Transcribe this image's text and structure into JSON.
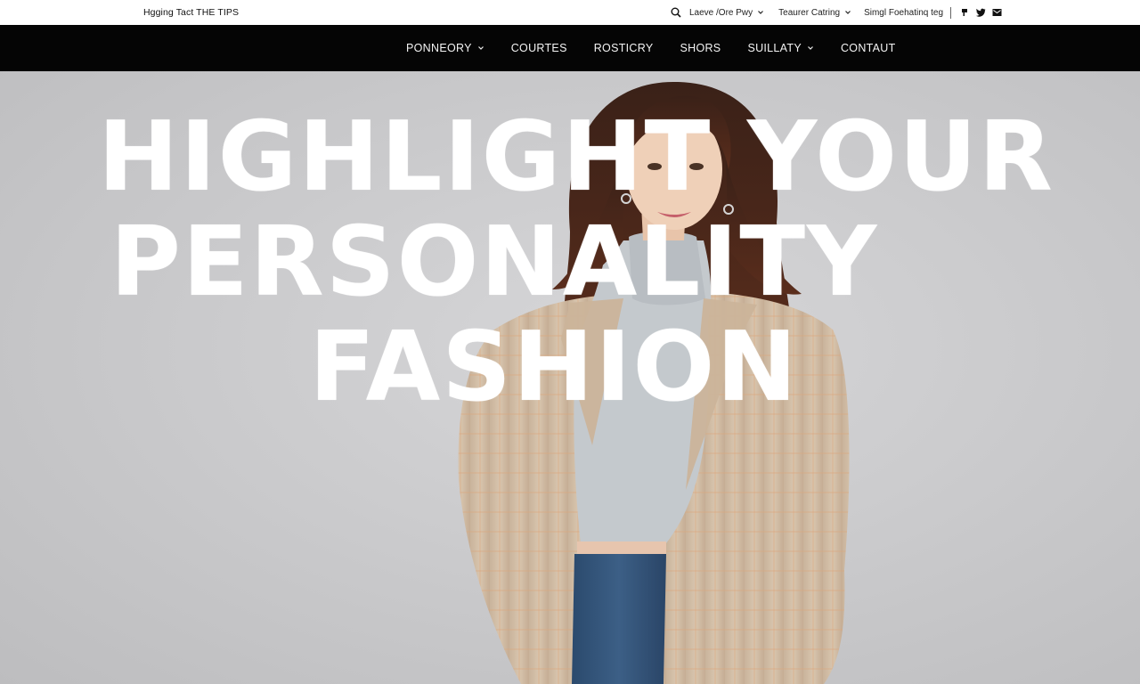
{
  "topbar": {
    "brand": "Hgging Tact THE TIPS",
    "items": [
      {
        "label": "Laeve /Ore Pwy",
        "dropdown": true
      },
      {
        "label": "Teaurer Catring",
        "dropdown": true
      },
      {
        "label": "Simgl Foehatinq teg",
        "dropdown": false
      }
    ],
    "icons": [
      "search-icon",
      "pinterest-icon",
      "twitter-icon",
      "mail-icon"
    ]
  },
  "nav": {
    "items": [
      {
        "label": "PONNEORY",
        "dropdown": true
      },
      {
        "label": "COURTES",
        "dropdown": false
      },
      {
        "label": "ROSTICRY",
        "dropdown": false
      },
      {
        "label": "SHORS",
        "dropdown": false
      },
      {
        "label": "SUILLATY",
        "dropdown": true
      },
      {
        "label": "CONTAUT",
        "dropdown": false
      }
    ]
  },
  "hero": {
    "headline_lines": [
      "HIGHLIGHT YOUR",
      "PERSONALITY",
      "FASHION"
    ],
    "image": "woman-in-plaid-coat-photo"
  },
  "colors": {
    "nav_bg": "#050505",
    "topbar_bg": "#ffffff",
    "hero_bg": "#c9c9cb",
    "headline": "#ffffff"
  }
}
